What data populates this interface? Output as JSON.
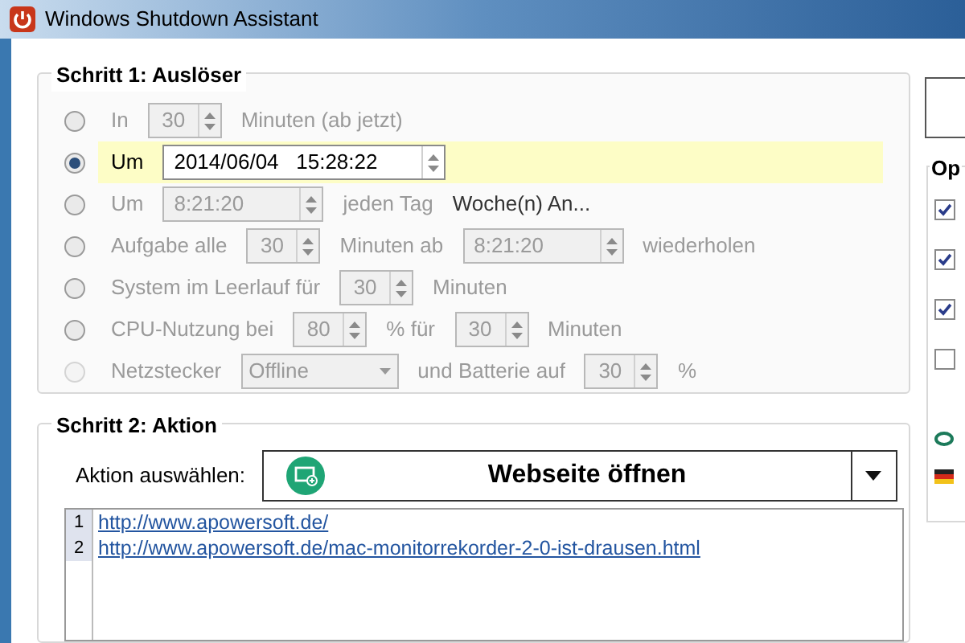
{
  "window": {
    "title": "Windows Shutdown Assistant"
  },
  "step1": {
    "title": "Schritt 1: Auslöser",
    "rows": [
      {
        "selected": false,
        "disabled": false,
        "parts": [
          {
            "kind": "text",
            "text": "In"
          },
          {
            "kind": "spin",
            "value": "30"
          },
          {
            "kind": "text",
            "text": "Minuten (ab jetzt)"
          }
        ]
      },
      {
        "selected": true,
        "disabled": false,
        "parts": [
          {
            "kind": "text",
            "text": "Um"
          },
          {
            "kind": "datetime",
            "value": "2014/06/04   15:28:22"
          }
        ]
      },
      {
        "selected": false,
        "disabled": false,
        "parts": [
          {
            "kind": "text",
            "text": "Um"
          },
          {
            "kind": "time",
            "value": "8:21:20"
          },
          {
            "kind": "text",
            "text": "jeden Tag"
          },
          {
            "kind": "link",
            "text": "Woche(n) An..."
          }
        ]
      },
      {
        "selected": false,
        "disabled": false,
        "parts": [
          {
            "kind": "text",
            "text": "Aufgabe alle"
          },
          {
            "kind": "spin",
            "value": "30"
          },
          {
            "kind": "text",
            "text": "Minuten ab"
          },
          {
            "kind": "time",
            "value": "8:21:20"
          },
          {
            "kind": "text",
            "text": "wiederholen"
          }
        ]
      },
      {
        "selected": false,
        "disabled": false,
        "parts": [
          {
            "kind": "text",
            "text": "System im Leerlauf für"
          },
          {
            "kind": "spin",
            "value": "30"
          },
          {
            "kind": "text",
            "text": "Minuten"
          }
        ]
      },
      {
        "selected": false,
        "disabled": false,
        "parts": [
          {
            "kind": "text",
            "text": "CPU-Nutzung bei"
          },
          {
            "kind": "spin",
            "value": "80"
          },
          {
            "kind": "text",
            "text": "% für"
          },
          {
            "kind": "spin",
            "value": "30"
          },
          {
            "kind": "text",
            "text": "Minuten"
          }
        ]
      },
      {
        "selected": false,
        "disabled": true,
        "parts": [
          {
            "kind": "text",
            "text": "Netzstecker"
          },
          {
            "kind": "select",
            "value": "Offline"
          },
          {
            "kind": "text",
            "text": "und Batterie auf"
          },
          {
            "kind": "spin",
            "value": "30"
          },
          {
            "kind": "text",
            "text": "%"
          }
        ]
      }
    ]
  },
  "step2": {
    "title": "Schritt 2: Aktion",
    "label": "Aktion auswählen:",
    "action": "Webseite öffnen",
    "lines": [
      {
        "number": "1",
        "text": "http://www.apowersoft.de/"
      },
      {
        "number": "2",
        "text": "http://www.apowersoft.de/mac-monitorrekorder-2-0-ist-drausen.html"
      }
    ]
  },
  "options": {
    "title": "Op",
    "checkboxes": [
      {
        "checked": true
      },
      {
        "checked": true
      },
      {
        "checked": true
      },
      {
        "checked": false
      }
    ]
  }
}
